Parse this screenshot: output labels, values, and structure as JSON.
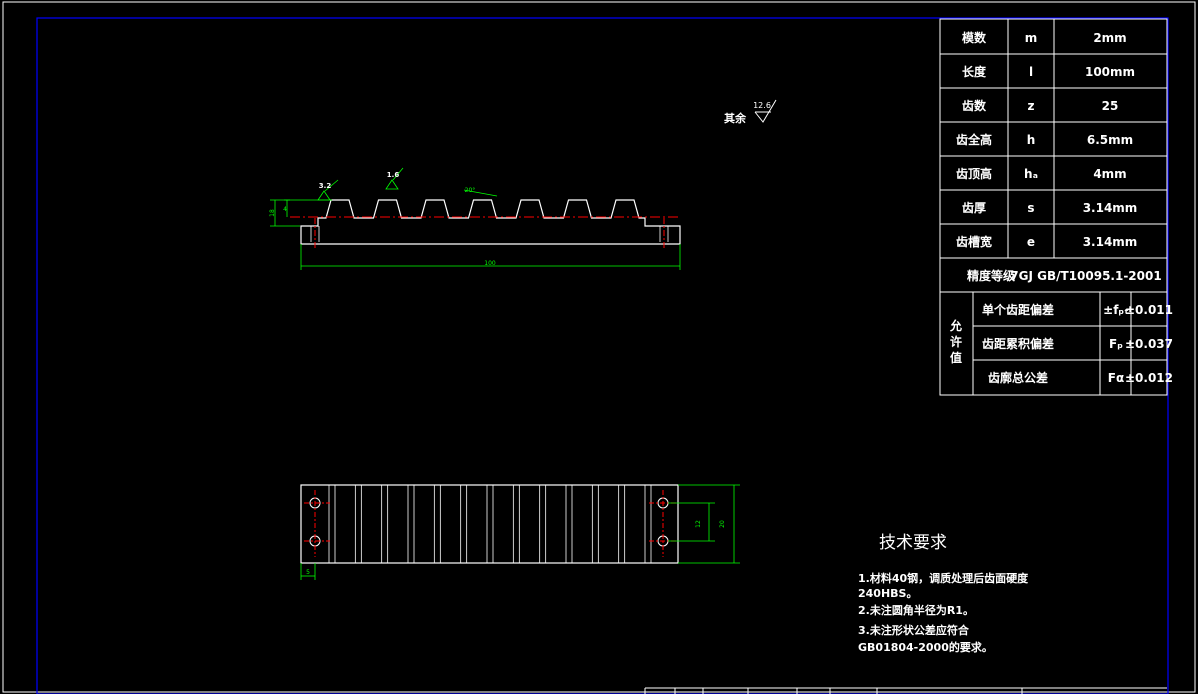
{
  "colors": {
    "background": "#000000",
    "frame_outer": "#ffffff",
    "frame_inner": "#0000ff",
    "outline": "#ffffff",
    "dimension": "#00ff00",
    "centerline": "#ff0000",
    "table_grid": "#ffffff"
  },
  "parameter_table": {
    "rows": [
      {
        "name": "模数",
        "symbol": "m",
        "value": "2mm"
      },
      {
        "name": "长度",
        "symbol": "l",
        "value": "100mm"
      },
      {
        "name": "齿数",
        "symbol": "z",
        "value": "25"
      },
      {
        "name": "齿全高",
        "symbol": "h",
        "value": "6.5mm"
      },
      {
        "name": "齿顶高",
        "symbol": "hₐ",
        "value": "4mm"
      },
      {
        "name": "齿厚",
        "symbol": "s",
        "value": "3.14mm"
      },
      {
        "name": "齿槽宽",
        "symbol": "e",
        "value": "3.14mm"
      }
    ],
    "accuracy_label": "精度等级",
    "accuracy_value": "7GJ GB/T10095.1-2001",
    "tolerance_group_label": "允许值",
    "tolerances": [
      {
        "name": "单个齿距偏差",
        "symbol": "±fₚₜ",
        "value": "±0.011"
      },
      {
        "name": "齿距累积偏差",
        "symbol": "Fₚ",
        "value": "±0.037"
      },
      {
        "name": "齿廓总公差",
        "symbol": "Fα",
        "value": "±0.012"
      }
    ]
  },
  "roughness": {
    "rest_label": "其余",
    "rest_value": "12.6",
    "flank_value": "3.2",
    "top_value": "1.6"
  },
  "front_view": {
    "tooth_count_drawn": 7,
    "dims": {
      "length": "100",
      "height": "18",
      "addendum": "4",
      "angle": "20°"
    }
  },
  "top_view": {
    "slot_count": 13,
    "dims": {
      "width": "20",
      "hole_spacing": "12",
      "edge": "5"
    }
  },
  "technical_requirements": {
    "title": "技术要求",
    "lines": [
      "1.材料40钢，调质处理后齿面硬度",
      "240HBS。",
      "2.未注圆角半径为R1。",
      "3.未注形状公差应符合",
      "GB01804-2000的要求。"
    ]
  }
}
